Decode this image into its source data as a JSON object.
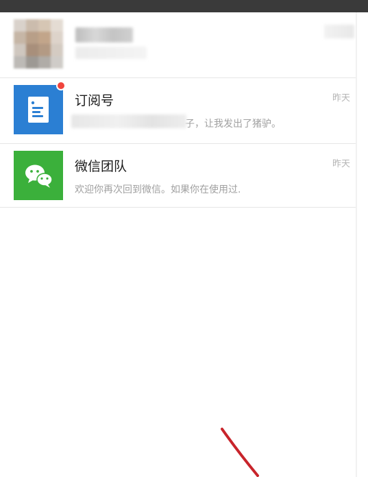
{
  "chats": [
    {
      "id": "contact",
      "name": "",
      "preview": "",
      "time": ""
    },
    {
      "id": "subscriptions",
      "name": "订阅号",
      "preview": "子，让我发出了猪驴。",
      "time": "昨天",
      "icon": "subscription-article-icon",
      "unread_dot": true,
      "color": "#2b7fd3"
    },
    {
      "id": "wechat-team",
      "name": "微信团队",
      "preview": "欢迎你再次回到微信。如果你在使用过.",
      "time": "昨天",
      "icon": "wechat-logo-icon",
      "color": "#3bb03b"
    }
  ],
  "colors": {
    "top_bar": "#3a3a3a",
    "badge": "#f0453d",
    "annotation_arrow": "#c8242b"
  }
}
